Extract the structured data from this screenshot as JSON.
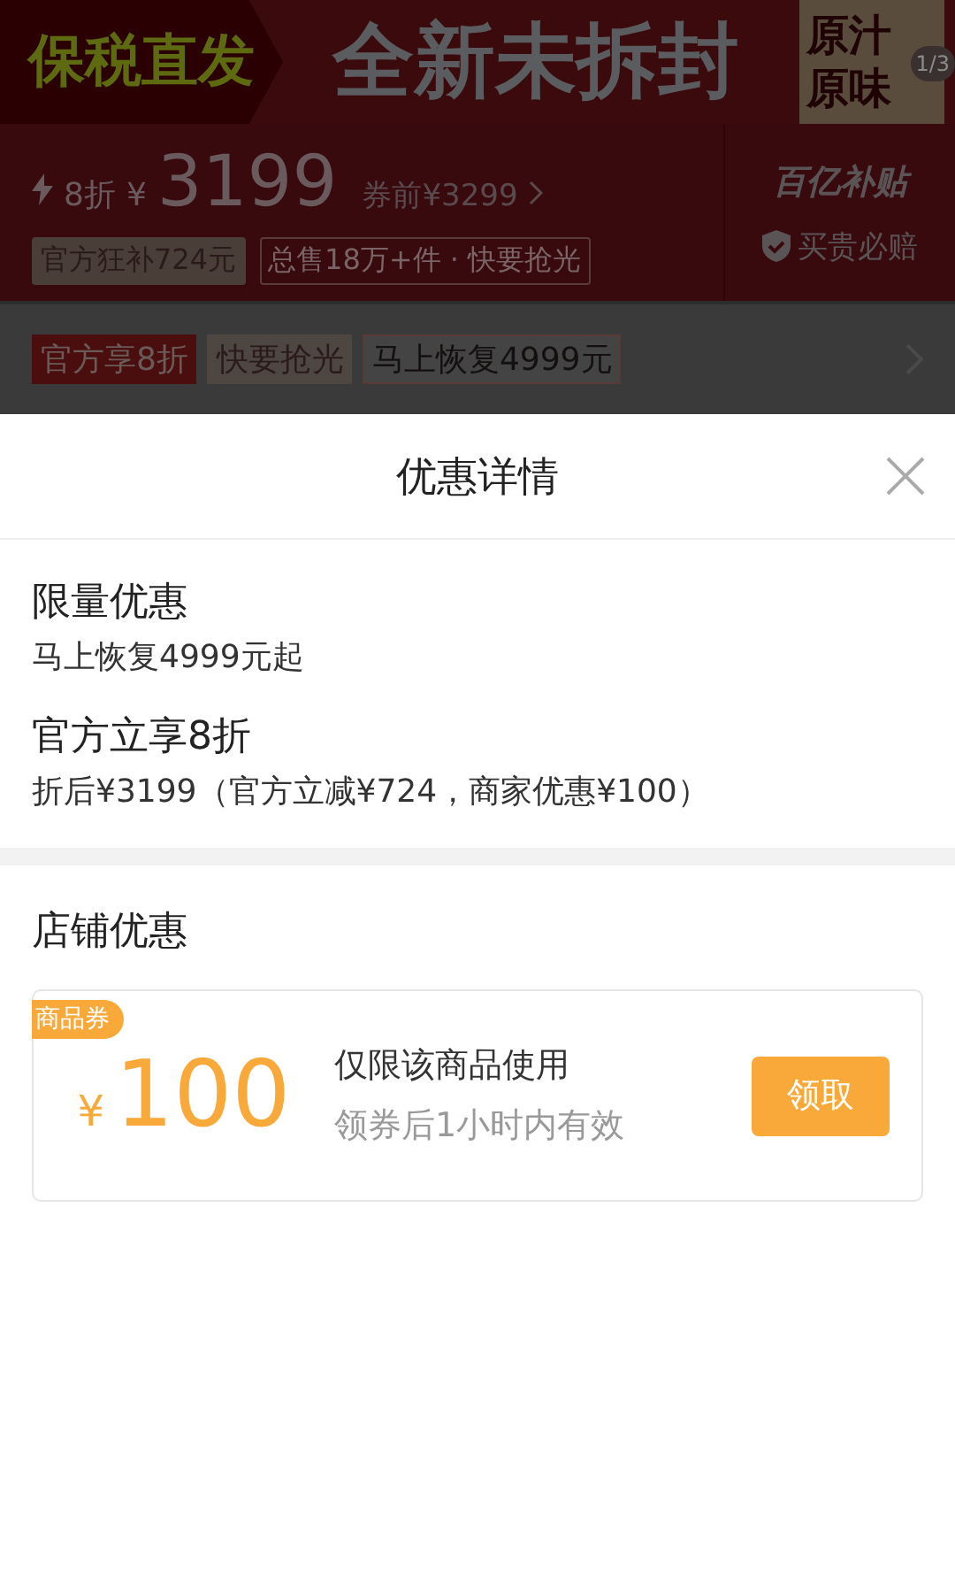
{
  "banner": {
    "tag": "保税直发",
    "headline": "全新未拆封",
    "side": [
      "原汁",
      "原味"
    ],
    "counter": "1/3"
  },
  "price": {
    "discount": "8折",
    "currency": "¥",
    "amount": "3199",
    "before": "券前¥3299",
    "tags": [
      {
        "text": "官方狂补724元",
        "kind": "filled"
      },
      {
        "text": "总售18万+件 · 快要抢光",
        "kind": "outline"
      }
    ],
    "brand": "百亿补贴",
    "guarantee": "买贵必赔"
  },
  "promo": {
    "tags": [
      {
        "text": "官方享8折",
        "kind": "filled"
      },
      {
        "text": "快要抢光",
        "kind": "plain"
      },
      {
        "text": "马上恢复4999元",
        "kind": "outline"
      }
    ]
  },
  "sheet": {
    "title": "优惠详情",
    "offers": [
      {
        "title": "限量优惠",
        "detail": "马上恢复4999元起"
      },
      {
        "title": "官方立享8折",
        "detail": "折后¥3199（官方立减¥724，商家优惠¥100）"
      }
    ],
    "store_title": "店铺优惠",
    "coupon": {
      "badge": "商品券",
      "currency": "¥",
      "amount": "100",
      "title": "仅限该商品使用",
      "detail": "领券后1小时内有效",
      "button": "领取"
    }
  }
}
